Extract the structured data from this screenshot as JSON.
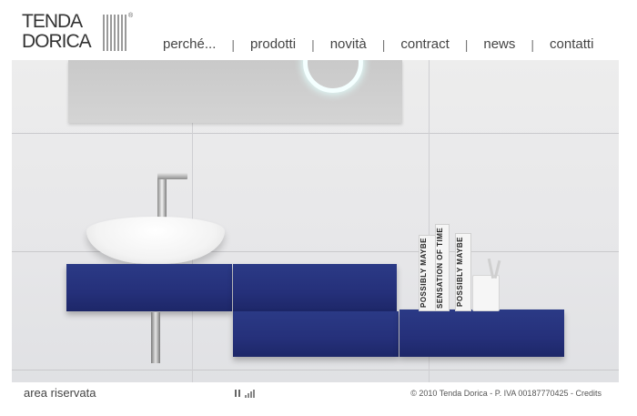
{
  "brand": {
    "line1": "TENDA",
    "line2": "DORICA",
    "registered": "®"
  },
  "nav": {
    "items": [
      {
        "label": "perché..."
      },
      {
        "label": "prodotti"
      },
      {
        "label": "novità"
      },
      {
        "label": "contract"
      },
      {
        "label": "news"
      },
      {
        "label": "contatti"
      }
    ],
    "separator": "|"
  },
  "hero": {
    "books": [
      {
        "title": "POSSIBLY MAYBE"
      },
      {
        "title": "SENSATION OF TIME"
      },
      {
        "title": "POSSIBLY MAYBE"
      }
    ]
  },
  "footer": {
    "area_riservata": "area riservata",
    "audio_icon": "pause-volume-icon",
    "copyright": "© 2010 Tenda Dorica - P. IVA 00187770425 - Credits"
  },
  "colors": {
    "shelf": "#25307a",
    "text": "#444444"
  }
}
